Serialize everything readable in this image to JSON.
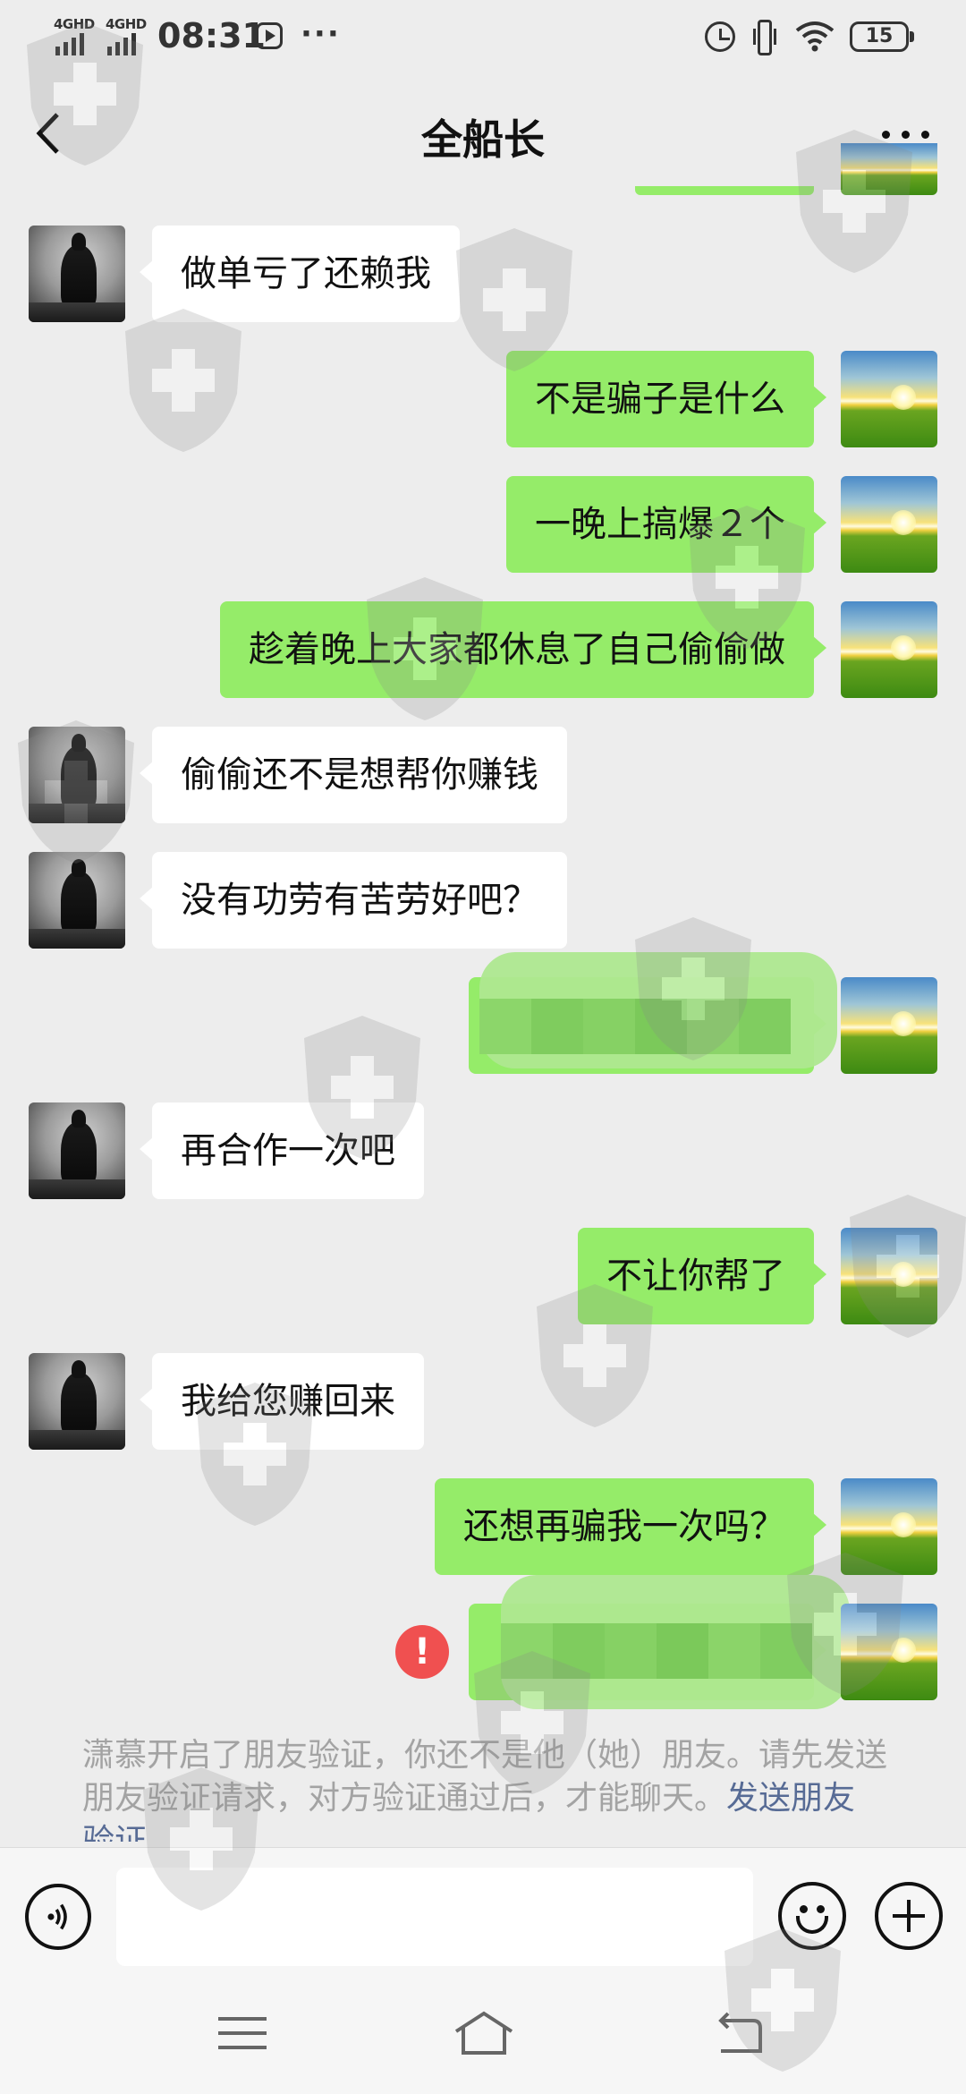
{
  "status_bar": {
    "network_1": "4GHD",
    "network_2": "4GHD",
    "time": "08:31",
    "dots": "···",
    "battery": "15"
  },
  "header": {
    "title": "全船长"
  },
  "messages": [
    {
      "side": "in",
      "text": "做单亏了还赖我"
    },
    {
      "side": "out",
      "text": "不是骗子是什么"
    },
    {
      "side": "out",
      "text": "一晚上搞爆２个"
    },
    {
      "side": "out",
      "text": "趁着晚上大家都休息了自己偷偷做"
    },
    {
      "side": "in",
      "text": "偷偷还不是想帮你赚钱"
    },
    {
      "side": "in",
      "text": "没有功劳有苦劳好吧？"
    },
    {
      "side": "out",
      "text": "",
      "redacted": true
    },
    {
      "side": "in",
      "text": "再合作一次吧"
    },
    {
      "side": "out",
      "text": "不让你帮了"
    },
    {
      "side": "in",
      "text": "我给您赚回来"
    },
    {
      "side": "out",
      "text": "还想再骗我一次吗？"
    },
    {
      "side": "out",
      "text": "",
      "redacted": true,
      "failed": true
    }
  ],
  "error_mark": "!",
  "system_note": {
    "text": "潇慕开启了朋友验证，你还不是他（她）朋友。请先发送朋友验证请求，对方验证通过后，才能聊天。",
    "link": "发送朋友验证"
  },
  "input_bar": {
    "placeholder": ""
  },
  "icons": {
    "back": "chevron-left-icon",
    "more": "more-dots-icon",
    "voice": "voice-icon",
    "emoji": "emoji-icon",
    "plus": "plus-icon",
    "error": "error-icon"
  },
  "colors": {
    "background": "#ededed",
    "bubble_out": "#95ec69",
    "bubble_in": "#ffffff",
    "link": "#576b95",
    "error": "#f05050"
  }
}
